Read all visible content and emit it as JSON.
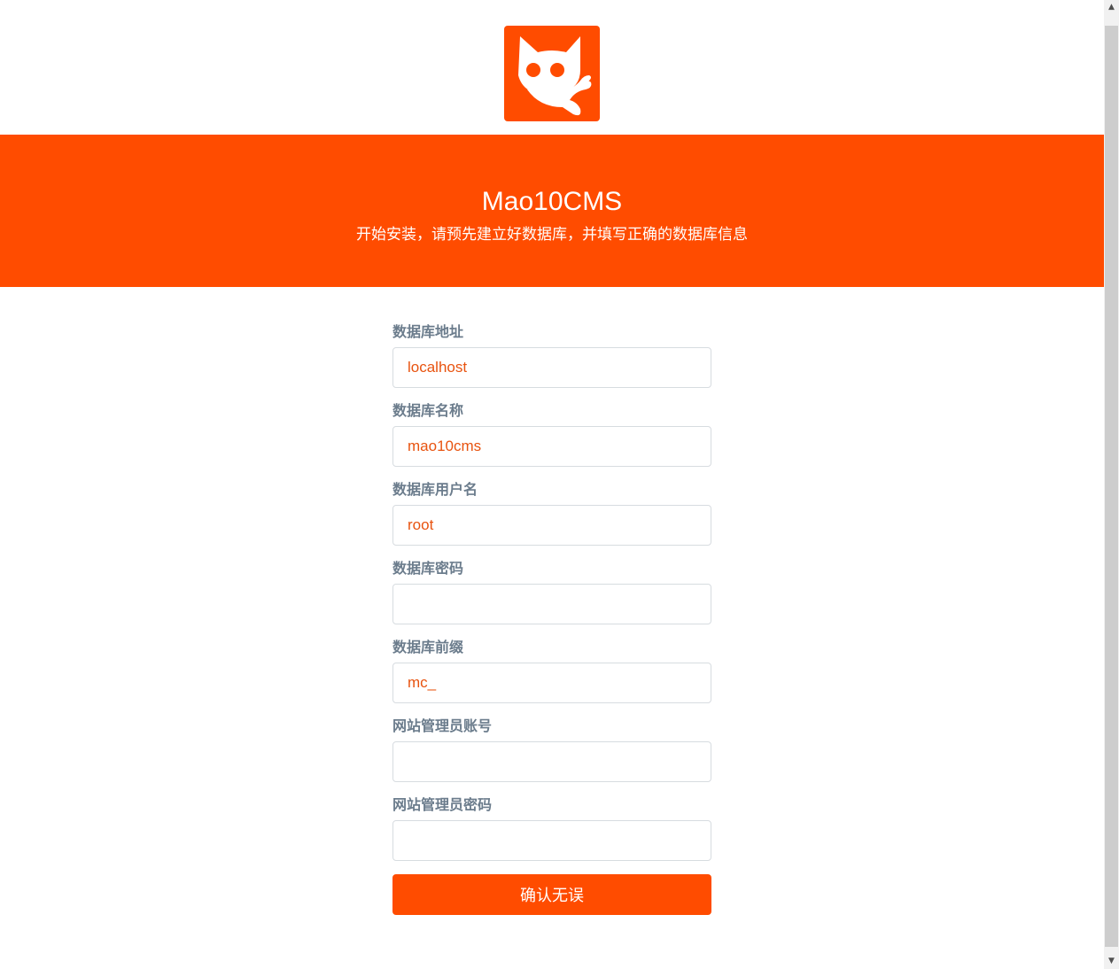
{
  "header": {
    "logo_icon": "cat-logo-icon",
    "title": "Mao10CMS",
    "subtitle": "开始安装，请预先建立好数据库，并填写正确的数据库信息"
  },
  "form": {
    "fields": [
      {
        "label": "数据库地址",
        "value": "localhost"
      },
      {
        "label": "数据库名称",
        "value": "mao10cms"
      },
      {
        "label": "数据库用户名",
        "value": "root"
      },
      {
        "label": "数据库密码",
        "value": ""
      },
      {
        "label": "数据库前缀",
        "value": "mc_"
      },
      {
        "label": "网站管理员账号",
        "value": ""
      },
      {
        "label": "网站管理员密码",
        "value": ""
      }
    ],
    "submit_label": "确认无误"
  },
  "colors": {
    "brand": "#ff4c00",
    "label": "#6b7c8c",
    "input_text": "#e8530f"
  }
}
